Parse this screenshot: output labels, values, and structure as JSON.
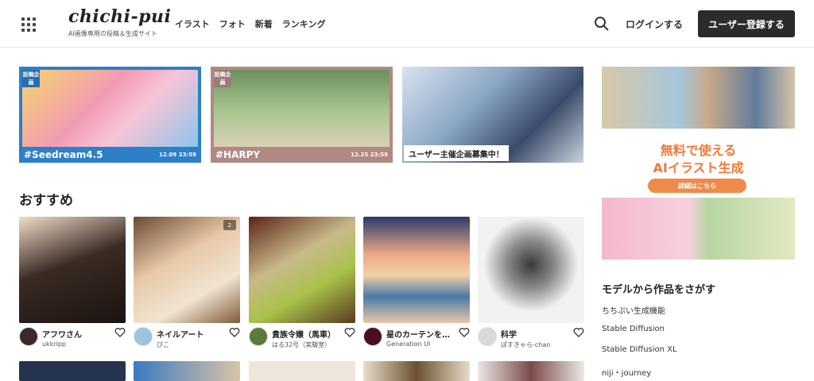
{
  "header": {
    "logo": "chichi-pui",
    "tagline": "AI画像専用の投稿＆生成サイト",
    "nav": [
      "イラスト",
      "フォト",
      "新着",
      "ランキング"
    ],
    "login_label": "ログインする",
    "register_label": "ユーザー登録する"
  },
  "banners": [
    {
      "tag": "投稿企画",
      "name": "#Seedream4.5",
      "date": "12.09 23:59"
    },
    {
      "tag": "投稿企画",
      "name": "#HARPY",
      "date": "12.25 23:59"
    },
    {
      "label": "ユーザー主催企画募集中！"
    }
  ],
  "section": {
    "title": "おすすめ"
  },
  "cards": [
    {
      "title": "アフワさん",
      "user": "ukkripp",
      "avatar_color": "#3a2a2a"
    },
    {
      "title": "ネイルアート",
      "user": "ぴこ",
      "avatar_color": "#9cc3e0",
      "multi": "2"
    },
    {
      "title": "貴族令嬢（馬車）",
      "user": "はる32号（実験室）",
      "avatar_color": "#5a7a3a"
    },
    {
      "title": "星のカーテンを…",
      "user": "Generation UI",
      "avatar_color": "#4a1020"
    },
    {
      "title": "科学",
      "user": "ぽすきゃら-chan",
      "avatar_color": "#d9d9d9"
    }
  ],
  "promo": {
    "line1": "無料で使える",
    "line2": "AIイラスト生成",
    "button": "詳細はこちら"
  },
  "models": {
    "title": "モデルから作品をさがす",
    "items": [
      "ちちぷい生成機能",
      "Stable Diffusion",
      "Stable Diffusion XL",
      "niji・journey"
    ]
  },
  "colors": {
    "accent": "#f07a3a",
    "dark_button": "#2b2b2b",
    "banner_blue": "#2d7fc7",
    "banner_rose": "#b08a82"
  }
}
